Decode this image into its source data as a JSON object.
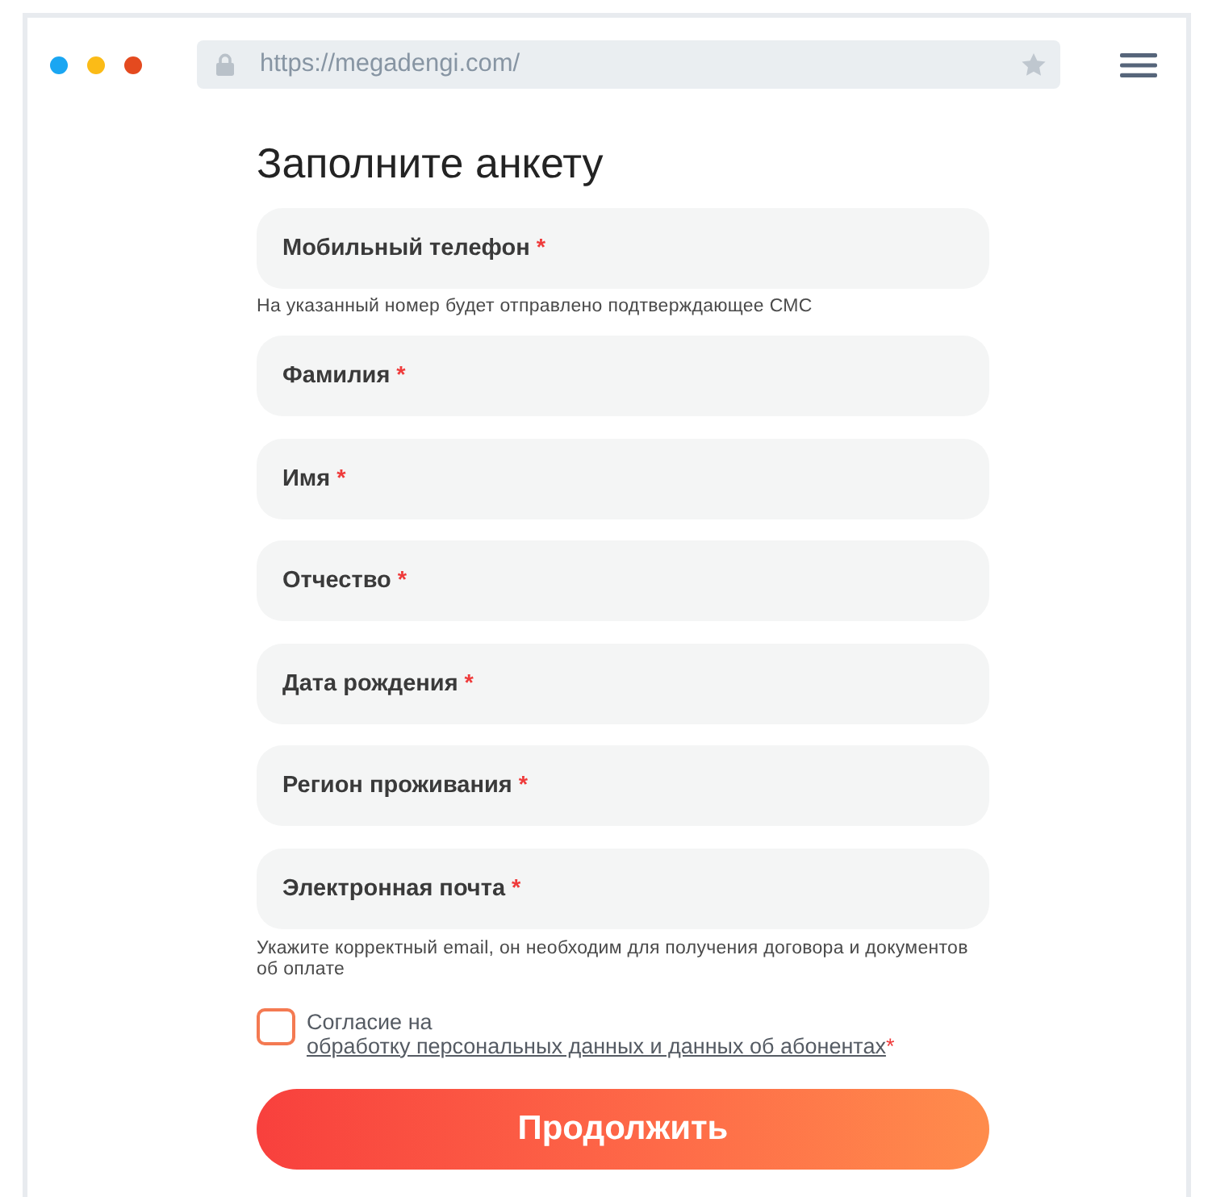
{
  "browser": {
    "url": "https://megadengi.com/"
  },
  "form": {
    "title": "Заполните анкету",
    "fields": [
      {
        "label": "Мобильный телефон",
        "required_mark": "*",
        "hint": "На указанный номер будет отправлено подтверждающее СМС"
      },
      {
        "label": "Фамилия",
        "required_mark": "*"
      },
      {
        "label": "Имя",
        "required_mark": "*"
      },
      {
        "label": "Отчество",
        "required_mark": "*"
      },
      {
        "label": "Дата рождения",
        "required_mark": "*"
      },
      {
        "label": "Регион проживания",
        "required_mark": "*"
      },
      {
        "label": "Электронная почта",
        "required_mark": "*",
        "hint": "Укажите корректный email, он необходим для получения договора и документов об оплате"
      }
    ],
    "consent": {
      "checked": false,
      "text": "Согласие на",
      "link": "обработку персональных данных и данных об абонентах",
      "required_mark": "*"
    },
    "submit": {
      "label": "Продолжить"
    }
  }
}
